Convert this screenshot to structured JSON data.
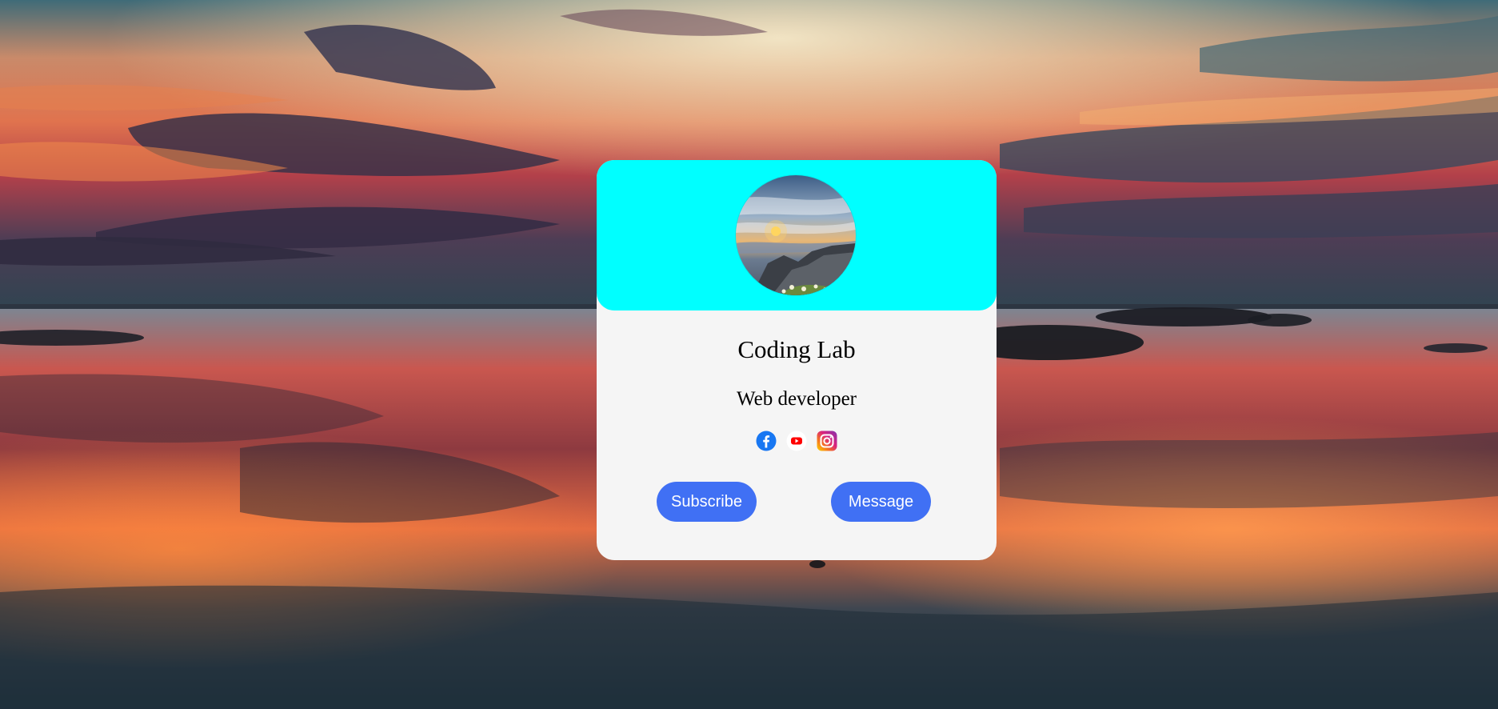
{
  "profile": {
    "name": "Coding Lab",
    "role": "Web developer"
  },
  "socials": [
    {
      "icon": "facebook-icon"
    },
    {
      "icon": "youtube-icon"
    },
    {
      "icon": "instagram-icon"
    }
  ],
  "actions": {
    "subscribe_label": "Subscribe",
    "message_label": "Message"
  },
  "colors": {
    "header": "#00ffff",
    "card": "#f5f5f5",
    "button": "#4070f4",
    "facebook": "#1877f2",
    "youtube": "#ff0000"
  }
}
